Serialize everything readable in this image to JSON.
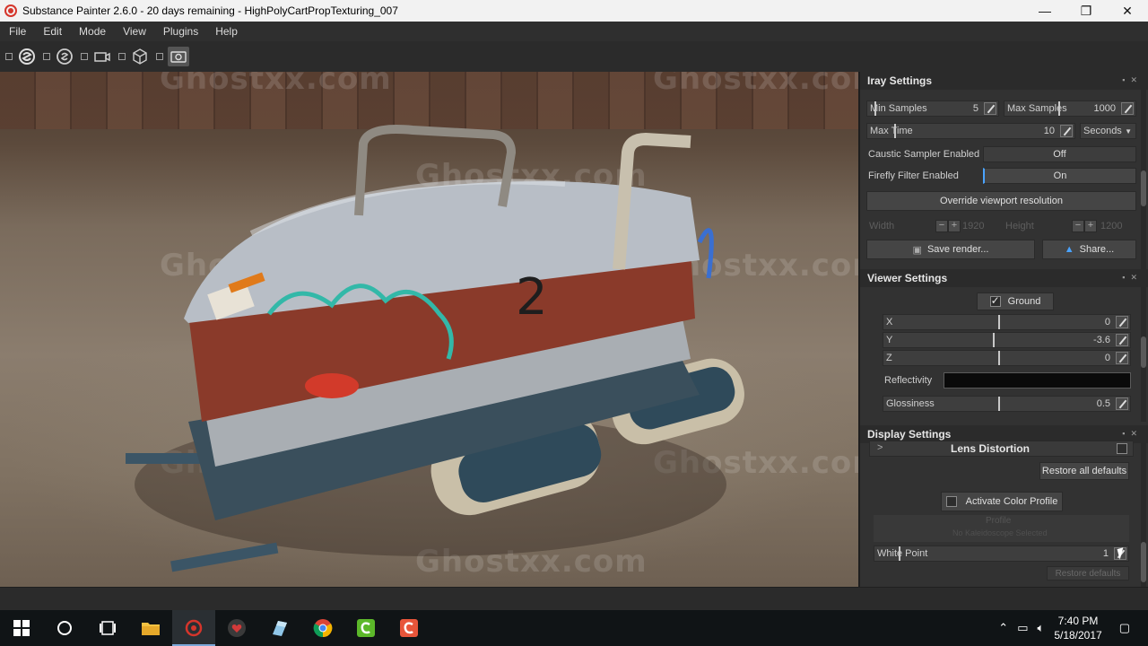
{
  "window": {
    "title": "Substance Painter 2.6.0 - 20 days remaining - HighPolyCartPropTexturing_007",
    "minimize_glyph": "—",
    "maximize_glyph": "❐",
    "close_glyph": "✕"
  },
  "menu": {
    "items": [
      "File",
      "Edit",
      "Mode",
      "View",
      "Plugins",
      "Help"
    ]
  },
  "toolbar": {
    "icons": [
      "substance-logo-icon",
      "iray-icon",
      "camera-icon",
      "3d-cube-icon",
      "screenshot-icon"
    ]
  },
  "viewport": {
    "watermark": "Ghostxx.com",
    "cart_number": "2"
  },
  "iray": {
    "title": "Iray Settings",
    "min_samples_label": "Min Samples",
    "min_samples_value": "5",
    "max_samples_label": "Max Samples",
    "max_samples_value": "1000",
    "max_time_label": "Max Time",
    "max_time_value": "10",
    "time_unit": "Seconds",
    "caustic_label": "Caustic Sampler Enabled",
    "caustic_value": "Off",
    "firefly_label": "Firefly Filter Enabled",
    "firefly_value": "On",
    "override_label": "Override viewport resolution",
    "width_label": "Width",
    "width_value": "1920",
    "height_label": "Height",
    "height_value": "1200",
    "save_render_label": "Save render...",
    "share_label": "Share..."
  },
  "viewer": {
    "title": "Viewer Settings",
    "ground_label": "Ground",
    "x_label": "X",
    "x_value": "0",
    "y_label": "Y",
    "y_value": "-3.6",
    "z_label": "Z",
    "z_value": "0",
    "reflectivity_label": "Reflectivity",
    "glossiness_label": "Glossiness",
    "glossiness_value": "0.5"
  },
  "display": {
    "title": "Display Settings",
    "lens_label": "Lens Distortion",
    "restore_all_label": "Restore all defaults",
    "color_profile_label": "Activate Color Profile",
    "profile_label": "Profile",
    "no_profile_label": "No Kaleidoscope Selected",
    "white_point_label": "White Point",
    "white_point_value": "1",
    "restore_label": "Restore defaults"
  },
  "taskbar": {
    "time": "7:40 PM",
    "date": "5/18/2017"
  },
  "colors": {
    "accent": "#4aa3ff",
    "substance_red": "#d5352b",
    "panel_bg": "#323232",
    "taskbar_bg": "#101416"
  }
}
